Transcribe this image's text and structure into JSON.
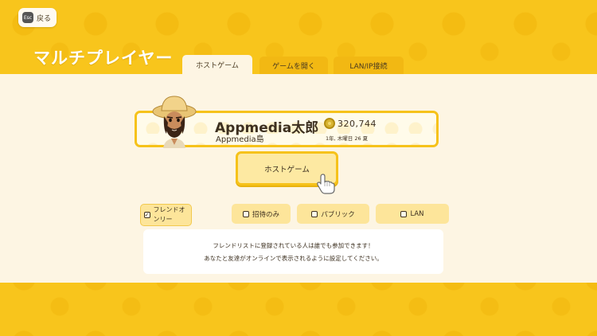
{
  "header": {
    "back_key": "Esc",
    "back_label": "戻る",
    "title": "マルチプレイヤー"
  },
  "tabs": [
    {
      "label": "ホストゲーム",
      "active": true
    },
    {
      "label": "ゲームを開く",
      "active": false
    },
    {
      "label": "LAN/IP接続",
      "active": false
    }
  ],
  "profile": {
    "name": "Appmedia太郎",
    "island": "Appmedia島",
    "bells": "320,744",
    "date": "1年, 木曜日 26 夏"
  },
  "host_button": {
    "label": "ホストゲーム"
  },
  "options": [
    {
      "label": "フレンドオンリー",
      "checked": true
    },
    {
      "label": "招待のみ",
      "checked": false
    },
    {
      "label": "パブリック",
      "checked": false
    },
    {
      "label": "LAN",
      "checked": false
    }
  ],
  "description": {
    "line1": "フレンドリストに登録されている人は誰でも参加できます！",
    "line2": "あなたと友達がオンラインで表示されるように設定してください。"
  },
  "colors": {
    "accent": "#f6c21a",
    "panel": "#fdf5e3",
    "text": "#3d3020"
  }
}
